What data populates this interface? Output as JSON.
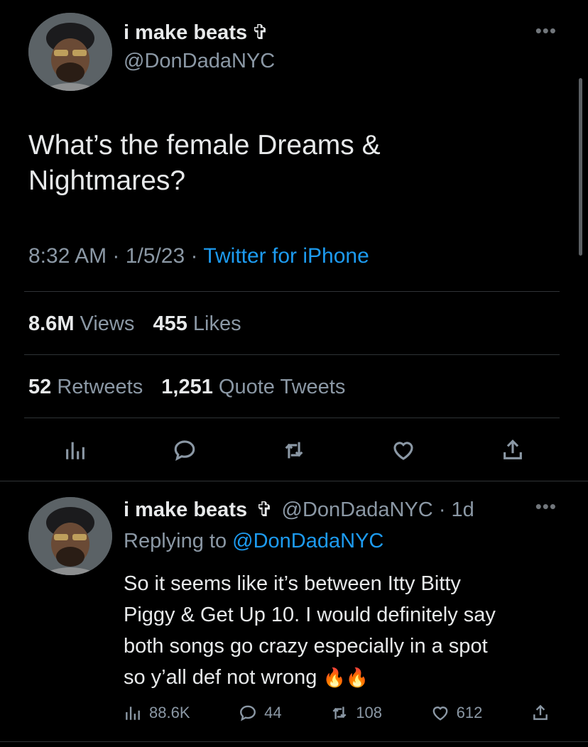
{
  "tweet": {
    "author_name": "i make beats",
    "author_badge": "✞",
    "author_handle": "@DonDadaNYC",
    "text_line1": "What’s the female Dreams &",
    "text_line2": "Nightmares?",
    "time": "8:32 AM",
    "date": "1/5/23",
    "separator": "·",
    "source": "Twitter for iPhone",
    "views_count": "8.6M",
    "views_label": "Views",
    "likes_count": "455",
    "likes_label": "Likes",
    "retweets_count": "52",
    "retweets_label": "Retweets",
    "quotes_count": "1,251",
    "quotes_label": "Quote Tweets",
    "more_icon": "more-dots-icon"
  },
  "actions": {
    "icons": [
      "analytics-icon",
      "reply-icon",
      "retweet-icon",
      "like-icon",
      "share-icon"
    ]
  },
  "reply": {
    "author_name": "i make beats",
    "author_badge": "✞",
    "author_handle": "@DonDadaNYC",
    "separator": "·",
    "time": "1d",
    "replying_prefix": "Replying to",
    "replying_to": "@DonDadaNYC",
    "text_line1": "So it seems like it’s between Itty Bitty",
    "text_line2": "Piggy & Get Up 10. I would definitely say",
    "text_line3": "both songs go crazy especially in a spot",
    "text_line4": "so y’all def not wrong",
    "emoji": "🔥🔥",
    "views": "88.6K",
    "replies": "44",
    "retweets": "108",
    "likes": "612"
  },
  "colors": {
    "background": "#000000",
    "text": "#e7e9ea",
    "secondary": "#8b98a5",
    "accent": "#1d9bf0",
    "divider": "#2f3336"
  }
}
